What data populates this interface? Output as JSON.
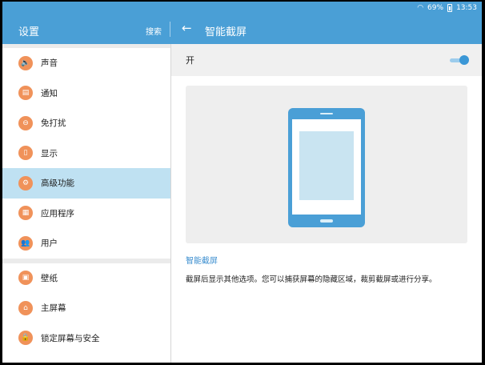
{
  "status": {
    "signal_icon": "wifi-icon",
    "battery_percent": "69%",
    "time": "13:53"
  },
  "appbar": {
    "left_title": "设置",
    "search_label": "搜索",
    "right_title": "智能截屏"
  },
  "sidebar": {
    "group1": [
      {
        "label": "声音",
        "icon": "volume-icon",
        "glyph": "🔈"
      },
      {
        "label": "通知",
        "icon": "notification-icon",
        "glyph": "▤"
      },
      {
        "label": "免打扰",
        "icon": "do-not-disturb-icon",
        "glyph": "⊖"
      },
      {
        "label": "显示",
        "icon": "display-icon",
        "glyph": "▯"
      },
      {
        "label": "高级功能",
        "icon": "advanced-features-icon",
        "glyph": "⚙",
        "active": true
      },
      {
        "label": "应用程序",
        "icon": "apps-icon",
        "glyph": "▦"
      },
      {
        "label": "用户",
        "icon": "users-icon",
        "glyph": "👥"
      }
    ],
    "group2": [
      {
        "label": "壁纸",
        "icon": "wallpaper-icon",
        "glyph": "▣"
      },
      {
        "label": "主屏幕",
        "icon": "home-screen-icon",
        "glyph": "⌂"
      },
      {
        "label": "锁定屏幕与安全",
        "icon": "lock-icon",
        "glyph": "🔒"
      }
    ]
  },
  "content": {
    "toggle_label": "开",
    "toggle_on": true,
    "section_title": "智能截屏",
    "description": "截屏后显示其他选项。您可以捕获屏幕的隐藏区域，裁剪截屏或进行分享。"
  },
  "colors": {
    "accent": "#4a9fd6",
    "icon_bg": "#f0925a",
    "active_row": "#bfe1f2"
  }
}
